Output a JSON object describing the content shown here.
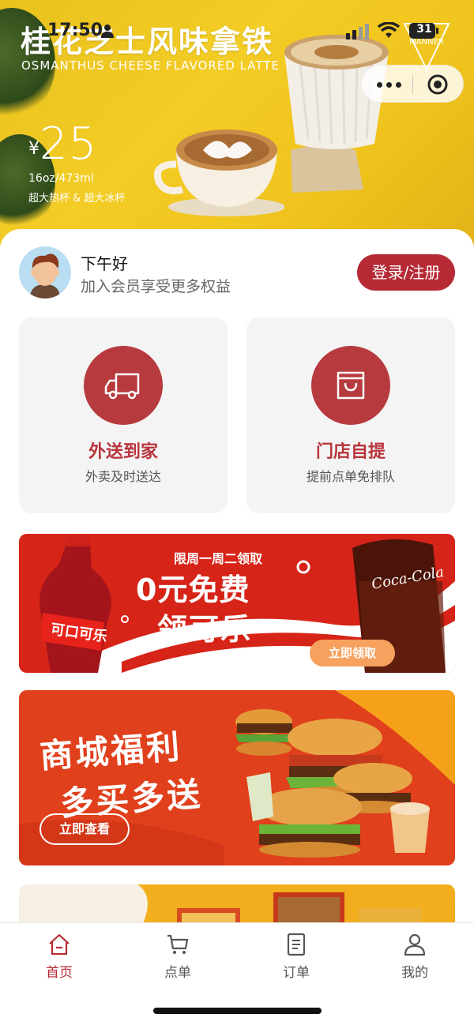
{
  "status_bar": {
    "time": "17:50",
    "battery": "31"
  },
  "hero": {
    "title": "桂花芝士风味拿铁",
    "subtitle": "OSMANTHUS CHEESE FLAVORED LATTE",
    "currency": "¥",
    "price": "25",
    "size": "16oz/473ml",
    "cups": "超大热杯 & 超大冰杯",
    "brand": "MANNER"
  },
  "user": {
    "greeting": "下午好",
    "description": "加入会员享受更多权益",
    "login_label": "登录/注册"
  },
  "services": [
    {
      "title": "外送到家",
      "subtitle": "外卖及时送达",
      "icon": "truck-icon"
    },
    {
      "title": "门店自提",
      "subtitle": "提前点单免排队",
      "icon": "bag-icon"
    }
  ],
  "banners": {
    "cola": {
      "top_text": "限周一周二领取",
      "line1": "0元免费",
      "line2": "领可乐",
      "button": "立即领取",
      "bottle_text": "可口可乐",
      "glass_text": "Coca-Cola"
    },
    "mall": {
      "line1": "商城福利",
      "line2": "多买多送",
      "button": "立即查看"
    }
  },
  "tabbar": {
    "items": [
      {
        "label": "首页",
        "icon": "home-icon",
        "active": true
      },
      {
        "label": "点单",
        "icon": "cart-icon",
        "active": false
      },
      {
        "label": "订单",
        "icon": "document-icon",
        "active": false
      },
      {
        "label": "我的",
        "icon": "person-icon",
        "active": false
      }
    ]
  },
  "colors": {
    "accent": "#b52a34",
    "hero_bg": "#f0c41c"
  }
}
